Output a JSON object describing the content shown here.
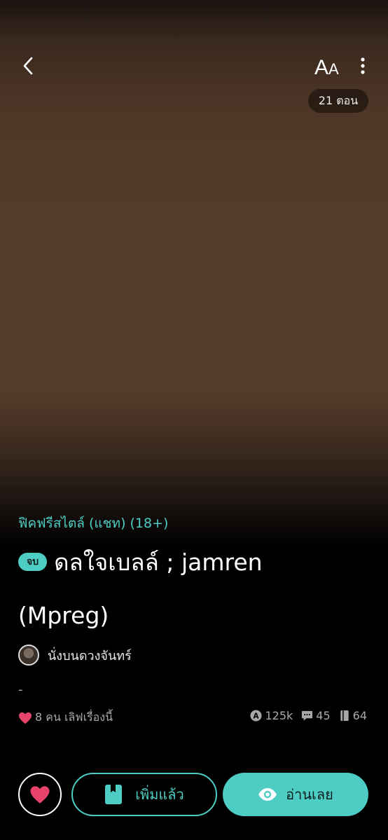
{
  "header": {
    "back_icon": "chevron-left-icon",
    "font_size_label": "AA",
    "more_icon": "more-vertical-icon"
  },
  "cover": {
    "episodes_label": "21 ตอน"
  },
  "story": {
    "category": "ฟิคฟรีสไตล์ (แชท) (18+)",
    "status_badge": "จบ",
    "title_line1": "ดลใจเบลล์ ; jamren",
    "title_line2": "(Mpreg)",
    "author_name": "นั่งบนดวงจันทร์",
    "description": "-"
  },
  "stats": {
    "likes_text": "8 คน เลิฟเรื่องนี้",
    "views": "125k",
    "comments": "45",
    "chapters": "64"
  },
  "actions": {
    "added_label": "เพิ่มแล้ว",
    "read_label": "อ่านเลย"
  },
  "colors": {
    "accent": "#4ecdc4",
    "heart": "#e8436a",
    "cover_brown": "#553b2a"
  }
}
